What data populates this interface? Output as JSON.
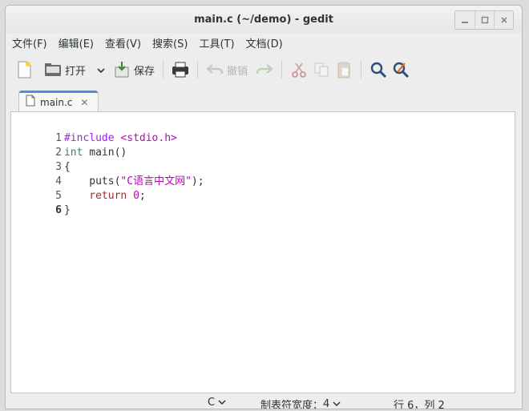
{
  "window": {
    "title": "main.c (~/demo) - gedit"
  },
  "window_controls": [
    "minimize",
    "maximize",
    "close"
  ],
  "menubar": {
    "items": [
      "文件(F)",
      "编辑(E)",
      "查看(V)",
      "搜索(S)",
      "工具(T)",
      "文档(D)"
    ]
  },
  "toolbar": {
    "new_icon": "new-document-icon",
    "open_label": "打开",
    "save_label": "保存",
    "undo_label": "撤销"
  },
  "tabs": [
    {
      "label": "main.c",
      "close": "✕"
    }
  ],
  "code": {
    "lines": [
      {
        "n": "1",
        "parts": [
          {
            "t": "#include ",
            "c": "#a020f0"
          },
          {
            "t": "<stdio.h>",
            "c": "#c000c0"
          }
        ]
      },
      {
        "n": "2",
        "parts": [
          {
            "t": "int",
            "c": "#2e8b57"
          },
          {
            "t": " main()",
            "c": "#2e3436"
          }
        ]
      },
      {
        "n": "3",
        "parts": [
          {
            "t": "{",
            "c": "#2e3436"
          }
        ]
      },
      {
        "n": "4",
        "parts": [
          {
            "t": "    puts(",
            "c": "#2e3436"
          },
          {
            "t": "\"C语言中文网\"",
            "c": "#c000c0"
          },
          {
            "t": ");",
            "c": "#2e3436"
          }
        ]
      },
      {
        "n": "5",
        "parts": [
          {
            "t": "    ",
            "c": "#2e3436"
          },
          {
            "t": "return",
            "c": "#a52a2a"
          },
          {
            "t": " ",
            "c": "#2e3436"
          },
          {
            "t": "0",
            "c": "#c000c0"
          },
          {
            "t": ";",
            "c": "#2e3436"
          }
        ]
      },
      {
        "n": "6",
        "parts": [
          {
            "t": "}",
            "c": "#2e3436"
          }
        ],
        "current": true
      }
    ]
  },
  "statusbar": {
    "language": "C",
    "tab_width_label": "制表符宽度：",
    "tab_width_value": "4",
    "position": "行 6，列 2"
  },
  "colors": {
    "tab_accent": "#4a90d9",
    "editor_bg": "#ffffff"
  }
}
